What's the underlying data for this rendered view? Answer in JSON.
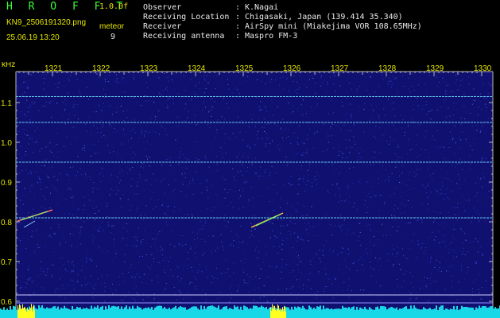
{
  "header": {
    "title": "H R O F F T",
    "version": "1.0.0f",
    "filename": "KN9_2506191320.png",
    "datetime": "25.06.19 13:20",
    "meteor_label": "meteor",
    "meteor_count": "9",
    "info": [
      {
        "label": "Observer",
        "value": "K.Nagai"
      },
      {
        "label": "Receiving Location",
        "value": "Chigasaki, Japan (139.414 35.340)"
      },
      {
        "label": "Receiver",
        "value": "AirSpy mini (Miakejima VOR 108.65MHz)"
      },
      {
        "label": "Receiving antenna",
        "value": "Maspro FM-3"
      }
    ]
  },
  "spectrogram": {
    "y_unit": "kHz",
    "x_ticks": [
      "1321",
      "1322",
      "1323",
      "1324",
      "1325",
      "1326",
      "1327",
      "1328",
      "1329",
      "1330"
    ],
    "y_ticks": [
      "1.1",
      "1.0",
      "0.9",
      "0.8",
      "0.7",
      "0.6"
    ],
    "background_color": "#101070",
    "carrier_lines_khz": [
      1.115,
      1.05,
      0.95,
      0.81
    ],
    "colors": {
      "axis": "#b8b8b8",
      "label": "#e6e600",
      "carrier": "#6fe8ff",
      "baseline": "#18d8e8",
      "burst": "#ffff20"
    }
  }
}
